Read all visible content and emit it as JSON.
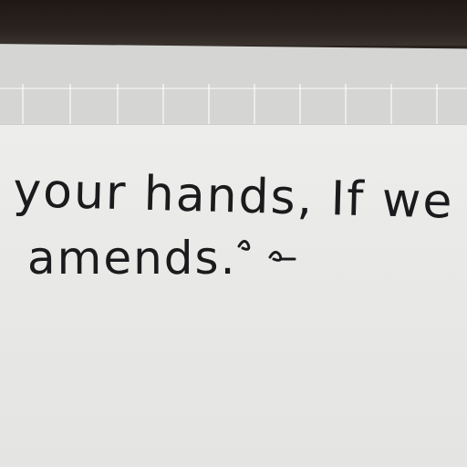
{
  "note": {
    "line1": "your hands, If we",
    "line2": "amends."
  },
  "colors": {
    "ink": "#1b1b1d",
    "paper": "#e9e9e7",
    "background": "#2a211c"
  }
}
